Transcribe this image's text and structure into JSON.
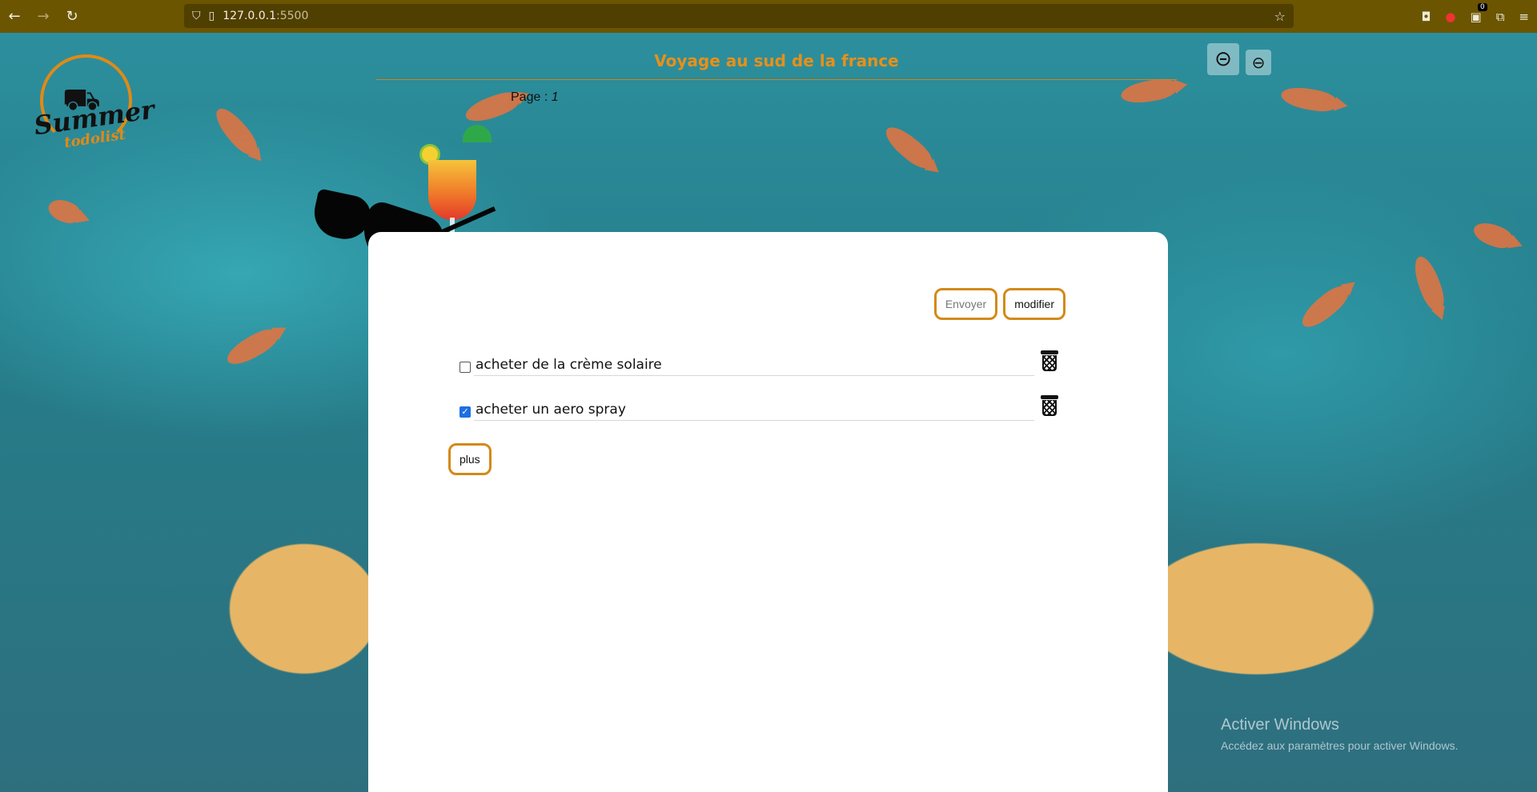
{
  "browser": {
    "url_host": "127.0.0.1",
    "url_port": ":5500",
    "extension_badge": "0"
  },
  "logo": {
    "title": "Summer",
    "subtitle": "todolist"
  },
  "header": {
    "title": "Voyage au sud de la france",
    "page_label": "Page :",
    "page_number": "1"
  },
  "actions": {
    "send_label": "Envoyer",
    "edit_label": "modifier",
    "more_label": "plus"
  },
  "todos": [
    {
      "text": "acheter de la crème solaire",
      "checked": false
    },
    {
      "text": "acheter un aero spray",
      "checked": true
    }
  ],
  "watermark": {
    "line1": "Activer Windows",
    "line2": "Accédez aux paramètres pour activer Windows."
  },
  "colors": {
    "accent": "#e8901a",
    "button_border": "#d38a17",
    "checkbox_checked": "#1f6fe0",
    "browser_bar": "#6b5500"
  }
}
